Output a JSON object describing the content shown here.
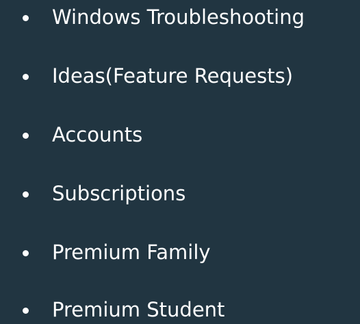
{
  "menu": {
    "items": [
      {
        "label": "Windows Troubleshooting"
      },
      {
        "label": "Ideas(Feature Requests)"
      },
      {
        "label": "Accounts"
      },
      {
        "label": "Subscriptions"
      },
      {
        "label": "Premium Family"
      },
      {
        "label": "Premium Student"
      }
    ]
  },
  "colors": {
    "background": "#213541",
    "text": "#ffffff"
  }
}
